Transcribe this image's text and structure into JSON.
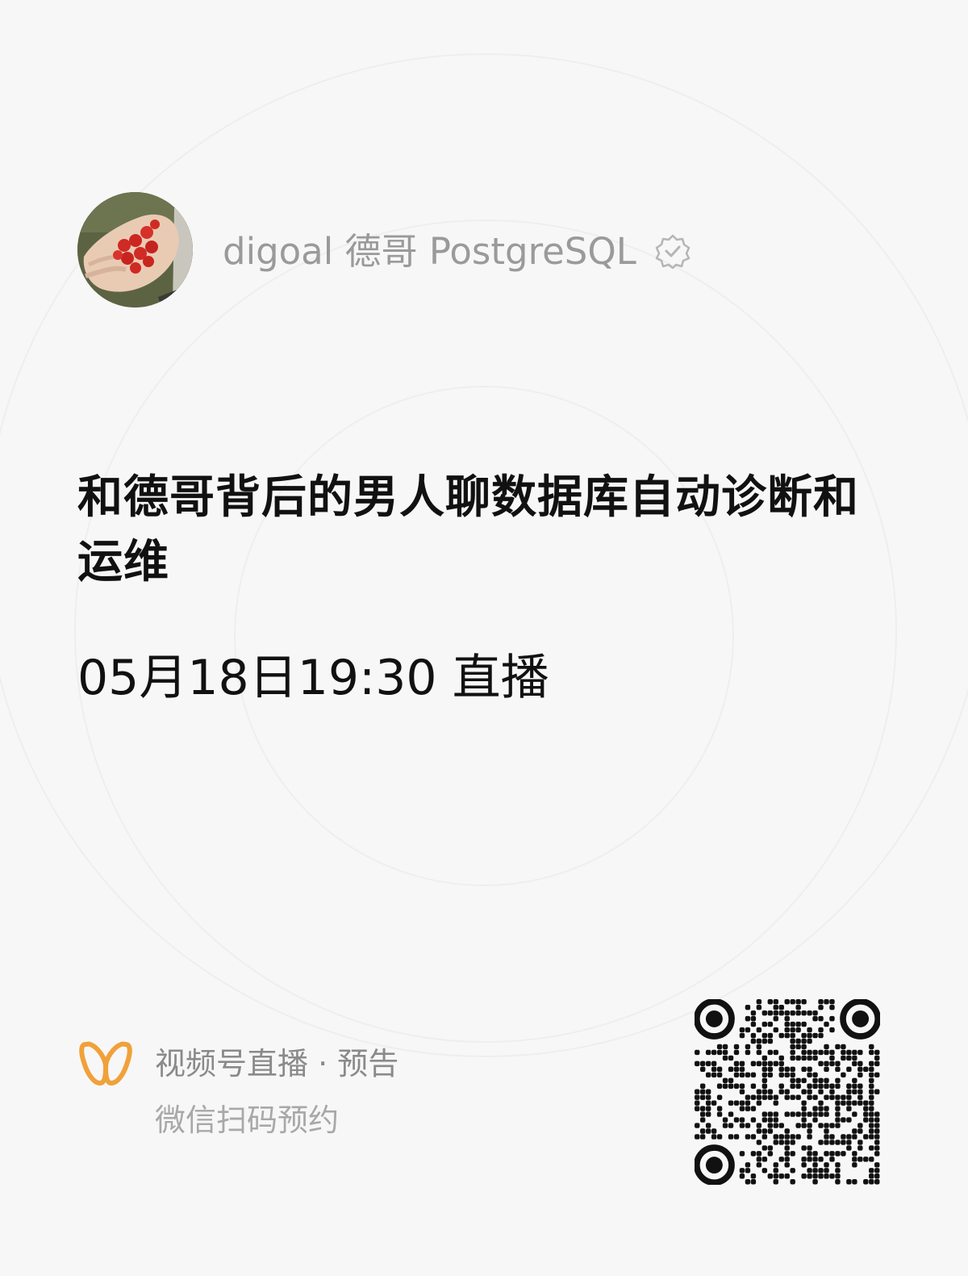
{
  "account": {
    "name": "digoal 德哥 PostgreSQL",
    "verified_icon": "verified-badge-icon",
    "avatar_icon": "avatar-hand-with-berries"
  },
  "event": {
    "title": "和德哥背后的男人聊数据库自动诊断和运维",
    "time": "05月18日19:30 直播"
  },
  "footer": {
    "logo_icon": "wechat-channels-icon",
    "logo_color": "#f0a13a",
    "title": "视频号直播 · 预告",
    "hint": "微信扫码预约",
    "qr_icon": "qr-code"
  }
}
